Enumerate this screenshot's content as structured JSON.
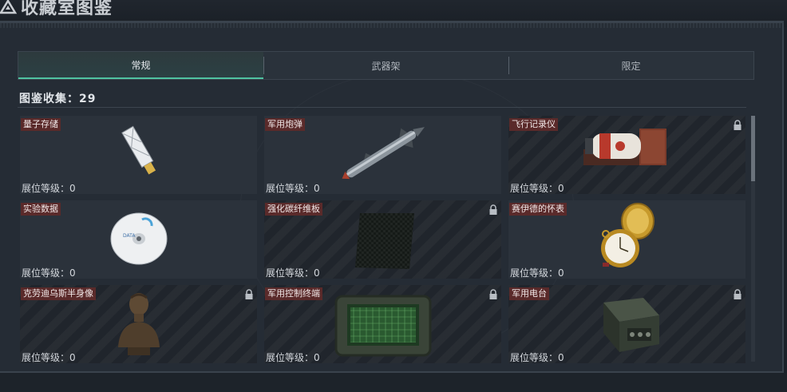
{
  "window": {
    "title": "收藏室图鉴",
    "icon": "triangle-logo-icon"
  },
  "tabs": [
    {
      "label": "常规",
      "active": true
    },
    {
      "label": "武器架",
      "active": false
    },
    {
      "label": "限定",
      "active": false
    }
  ],
  "collection": {
    "label": "图鉴收集：29"
  },
  "colors": {
    "accent": "#4fc3a1",
    "name_tag_bg": "#5a2a2a",
    "panel_bg": "#252c35"
  },
  "cards": [
    {
      "name": "量子存储",
      "level_label": "展位等级：",
      "level": "0",
      "locked": false,
      "icon": "usb-drive-icon"
    },
    {
      "name": "军用炮弹",
      "level_label": "展位等级：",
      "level": "0",
      "locked": false,
      "icon": "missile-icon"
    },
    {
      "name": "飞行记录仪",
      "level_label": "展位等级：",
      "level": "0",
      "locked": true,
      "icon": "flight-recorder-icon"
    },
    {
      "name": "实验数据",
      "level_label": "展位等级：",
      "level": "0",
      "locked": false,
      "icon": "disc-icon"
    },
    {
      "name": "强化碳纤维板",
      "level_label": "展位等级：",
      "level": "0",
      "locked": true,
      "icon": "carbon-plate-icon"
    },
    {
      "name": "赛伊德的怀表",
      "level_label": "展位等级：",
      "level": "0",
      "locked": false,
      "icon": "pocket-watch-icon"
    },
    {
      "name": "克劳迪乌斯半身像",
      "level_label": "展位等级：",
      "level": "0",
      "locked": true,
      "icon": "bust-icon"
    },
    {
      "name": "军用控制终端",
      "level_label": "展位等级：",
      "level": "0",
      "locked": true,
      "icon": "control-terminal-icon"
    },
    {
      "name": "军用电台",
      "level_label": "展位等级：",
      "level": "0",
      "locked": true,
      "icon": "radio-icon"
    }
  ]
}
